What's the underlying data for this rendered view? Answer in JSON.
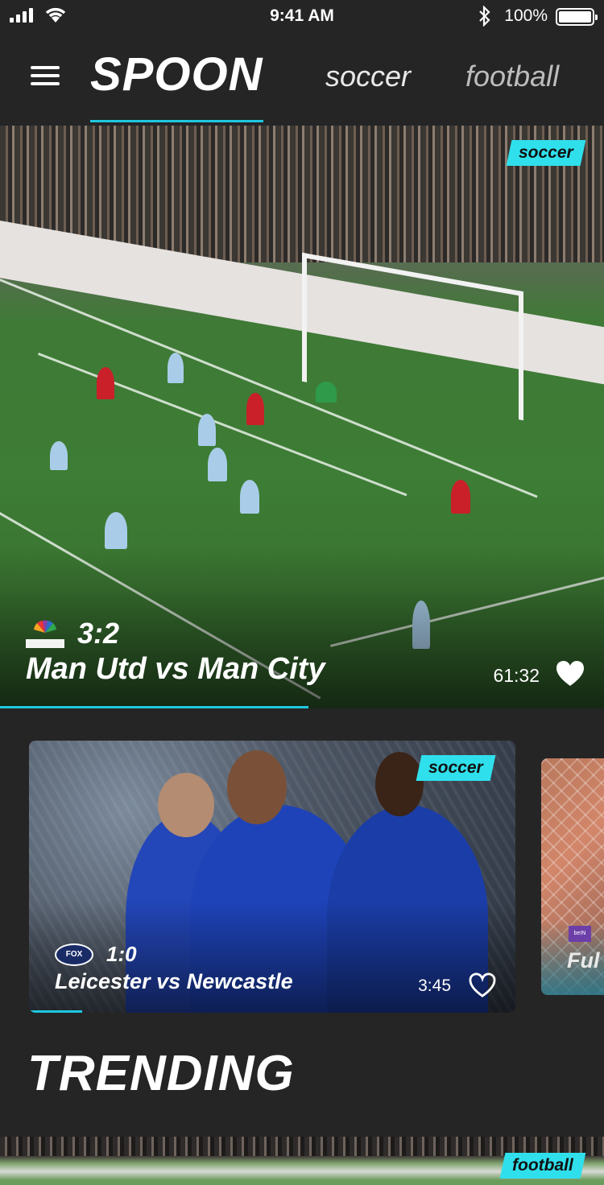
{
  "status_bar": {
    "time": "9:41 AM",
    "battery": "100%"
  },
  "nav": {
    "tabs": [
      {
        "label": "SPOON",
        "active": true
      },
      {
        "label": "soccer",
        "active": false
      },
      {
        "label": "football",
        "active": false
      }
    ]
  },
  "hero": {
    "tag": "soccer",
    "network_logo": "NBCSN",
    "score": "3:2",
    "title": "Man Utd vs Man City",
    "duration": "61:32",
    "favorited": true,
    "progress_fraction": 0.51
  },
  "cards": [
    {
      "tag": "soccer",
      "network_logo": "FOX SPORTS",
      "score": "1:0",
      "title": "Leicester vs Newcastle",
      "duration": "3:45",
      "favorited": false,
      "progress_fraction": 0.11
    },
    {
      "title_partial": "Ful"
    }
  ],
  "sections": {
    "trending_title": "TRENDING"
  },
  "trending": [
    {
      "tag": "football"
    }
  ],
  "colors": {
    "accent": "#2fe0ec",
    "background": "#252525"
  }
}
